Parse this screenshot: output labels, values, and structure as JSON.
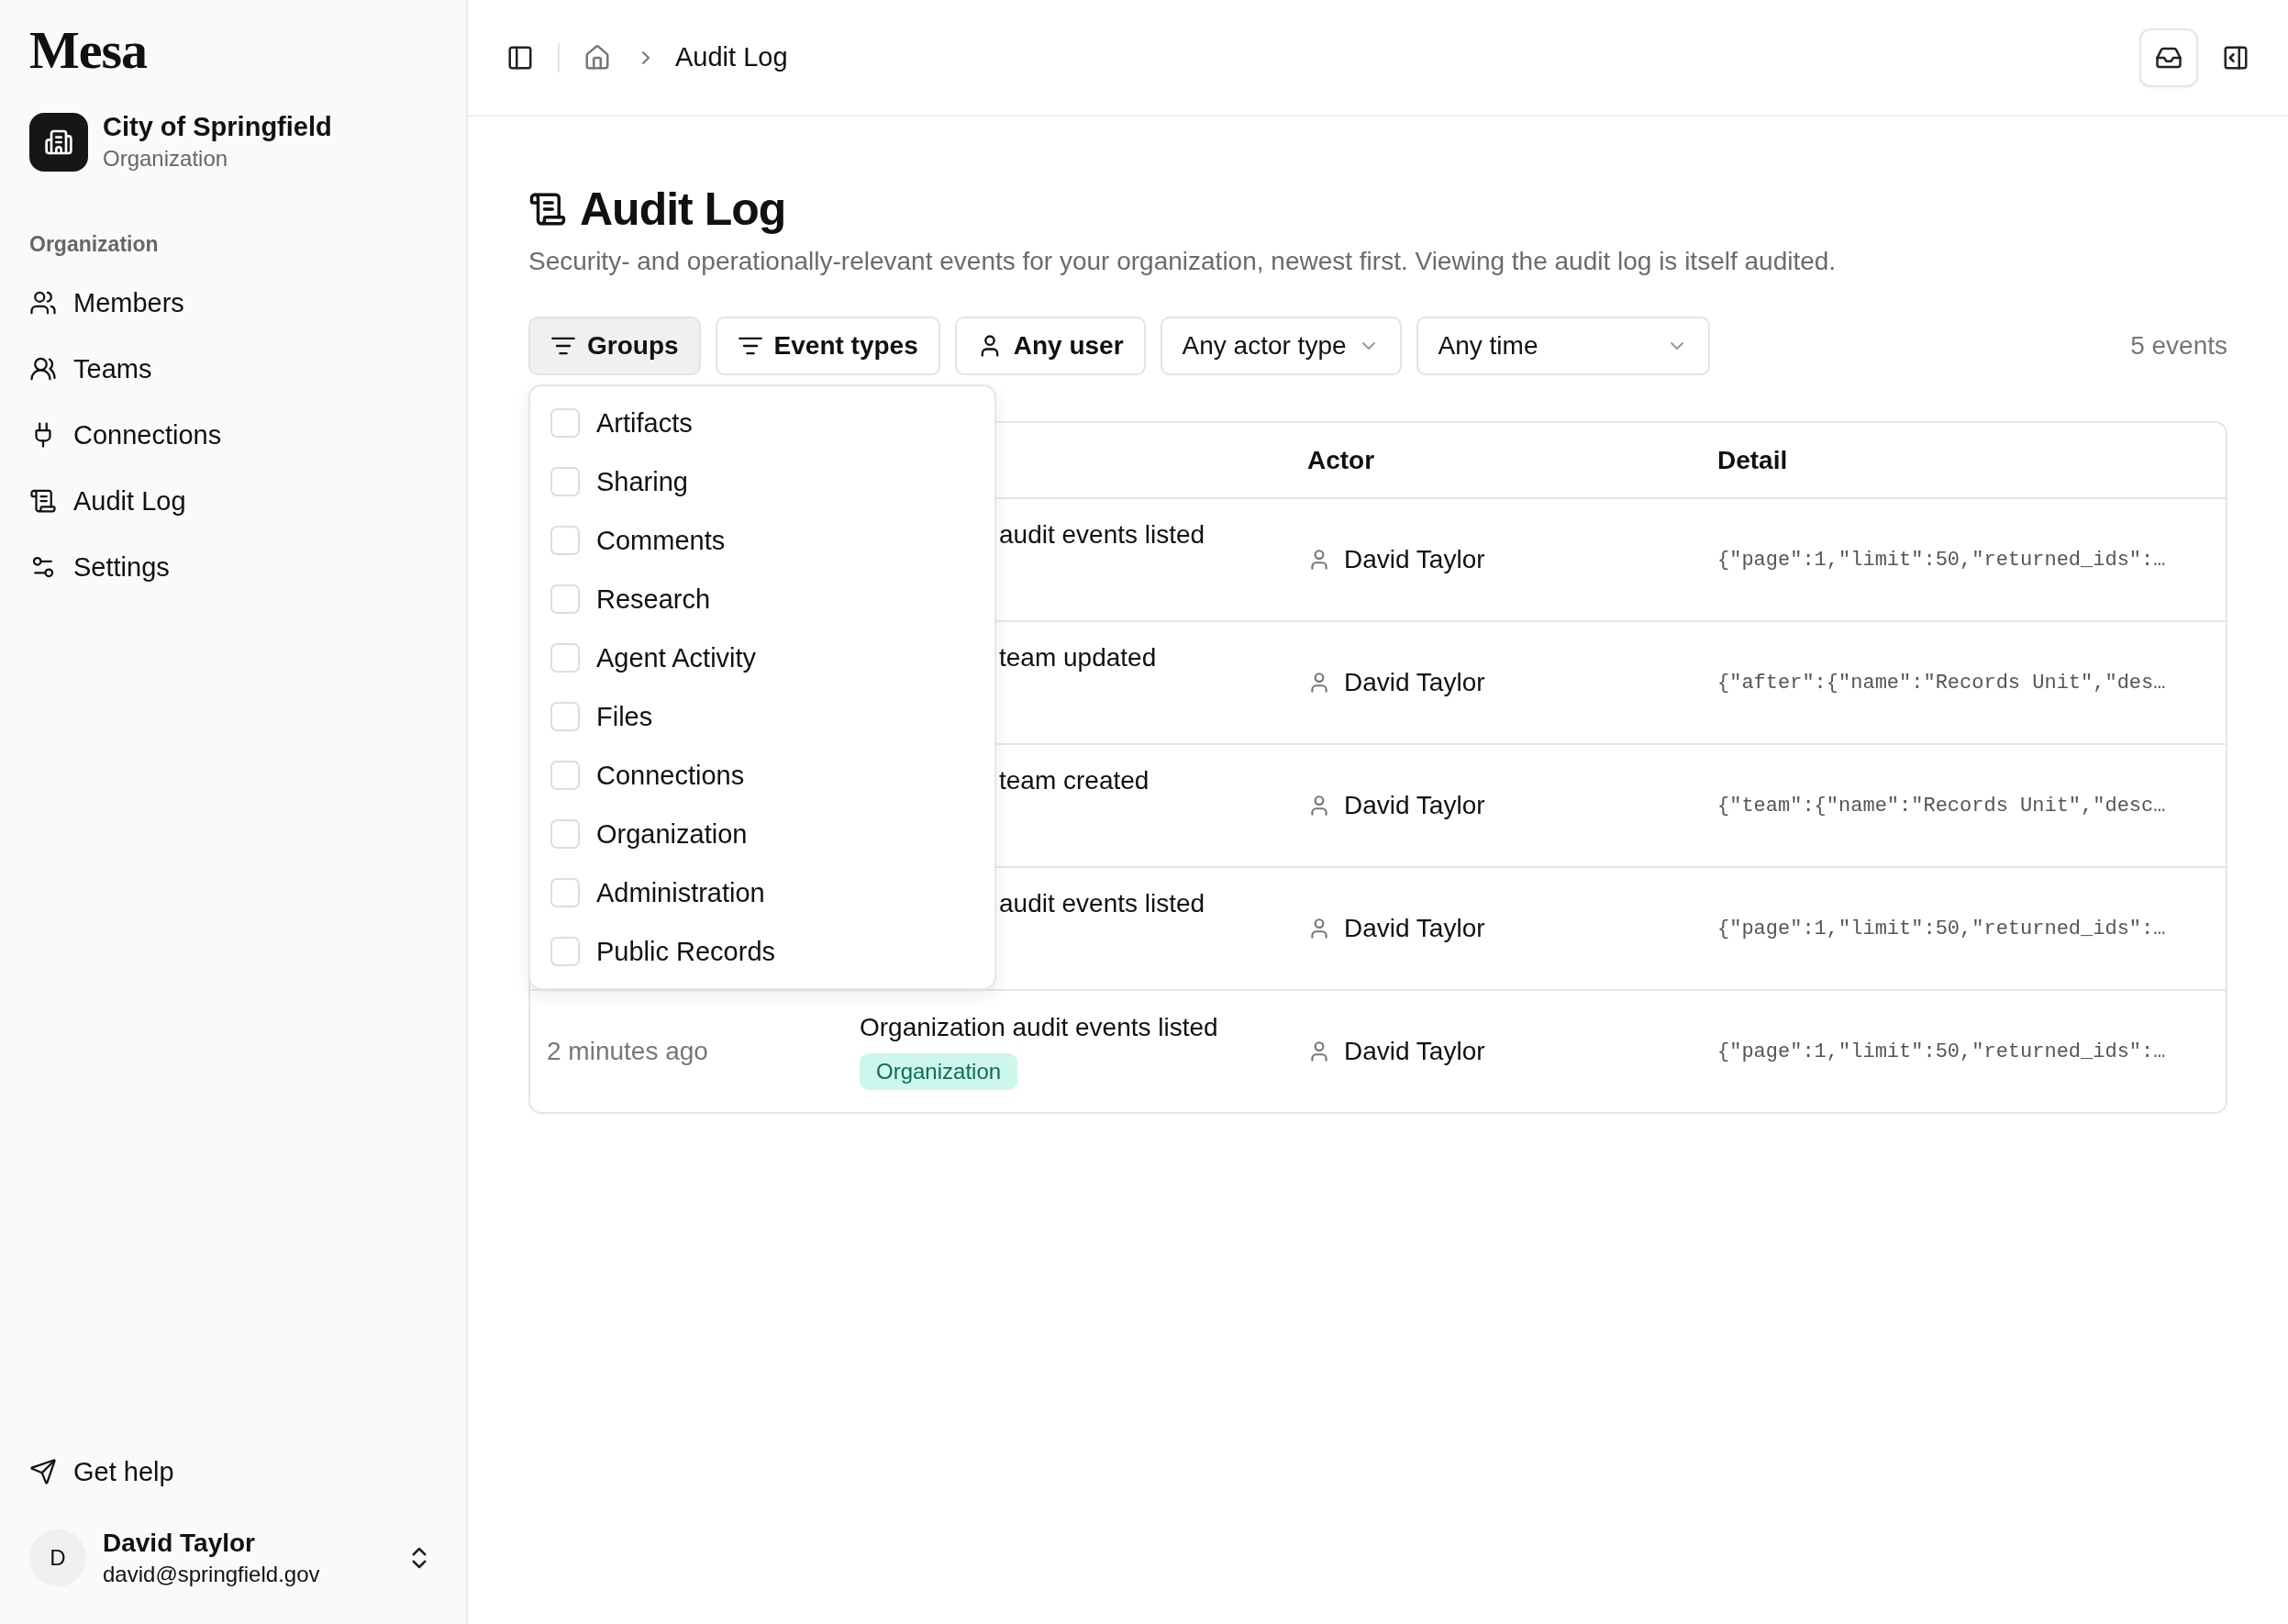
{
  "sidebar": {
    "logo": "Mesa",
    "org": {
      "name": "City of Springfield",
      "type": "Organization"
    },
    "section": "Organization",
    "items": [
      {
        "label": "Members"
      },
      {
        "label": "Teams"
      },
      {
        "label": "Connections"
      },
      {
        "label": "Audit Log"
      },
      {
        "label": "Settings"
      }
    ],
    "help": "Get help",
    "user": {
      "initial": "D",
      "name": "David Taylor",
      "email": "david@springfield.gov"
    }
  },
  "breadcrumb": {
    "current": "Audit Log"
  },
  "page": {
    "title": "Audit Log",
    "description": "Security- and operationally-relevant events for your organization, newest first. Viewing the audit log is itself audited."
  },
  "filters": [
    {
      "label": "Groups",
      "kind": "filter",
      "selected": true
    },
    {
      "label": "Event types",
      "kind": "filter",
      "selected": false
    },
    {
      "label": "Any user",
      "kind": "user",
      "selected": false
    },
    {
      "label": "Any actor type",
      "kind": "select",
      "selected": false
    },
    {
      "label": "Any time",
      "kind": "select",
      "selected": false
    }
  ],
  "count": "5 events",
  "groups_menu": {
    "options": [
      {
        "label": "Artifacts",
        "checked": false
      },
      {
        "label": "Sharing",
        "checked": false
      },
      {
        "label": "Comments",
        "checked": false
      },
      {
        "label": "Research",
        "checked": false
      },
      {
        "label": "Agent Activity",
        "checked": false
      },
      {
        "label": "Files",
        "checked": false
      },
      {
        "label": "Connections",
        "checked": false
      },
      {
        "label": "Organization",
        "checked": false
      },
      {
        "label": "Administration",
        "checked": false
      },
      {
        "label": "Public Records",
        "checked": false
      }
    ]
  },
  "table": {
    "columns": [
      "Actor",
      "Detail"
    ],
    "rows": [
      {
        "event": "audit events listed",
        "actor": "David Taylor",
        "detail": "{\"page\":1,\"limit\":50,\"returned_ids\":…"
      },
      {
        "event": "team updated",
        "actor": "David Taylor",
        "detail": "{\"after\":{\"name\":\"Records Unit\",\"des…"
      },
      {
        "event": "team created",
        "actor": "David Taylor",
        "detail": "{\"team\":{\"name\":\"Records Unit\",\"desc…"
      },
      {
        "event": "audit events listed",
        "actor": "David Taylor",
        "detail": "{\"page\":1,\"limit\":50,\"returned_ids\":…"
      },
      {
        "time": "2 minutes ago",
        "event": "Organization audit events listed",
        "tag": "Organization",
        "actor": "David Taylor",
        "detail": "{\"page\":1,\"limit\":50,\"returned_ids\":…"
      }
    ]
  }
}
